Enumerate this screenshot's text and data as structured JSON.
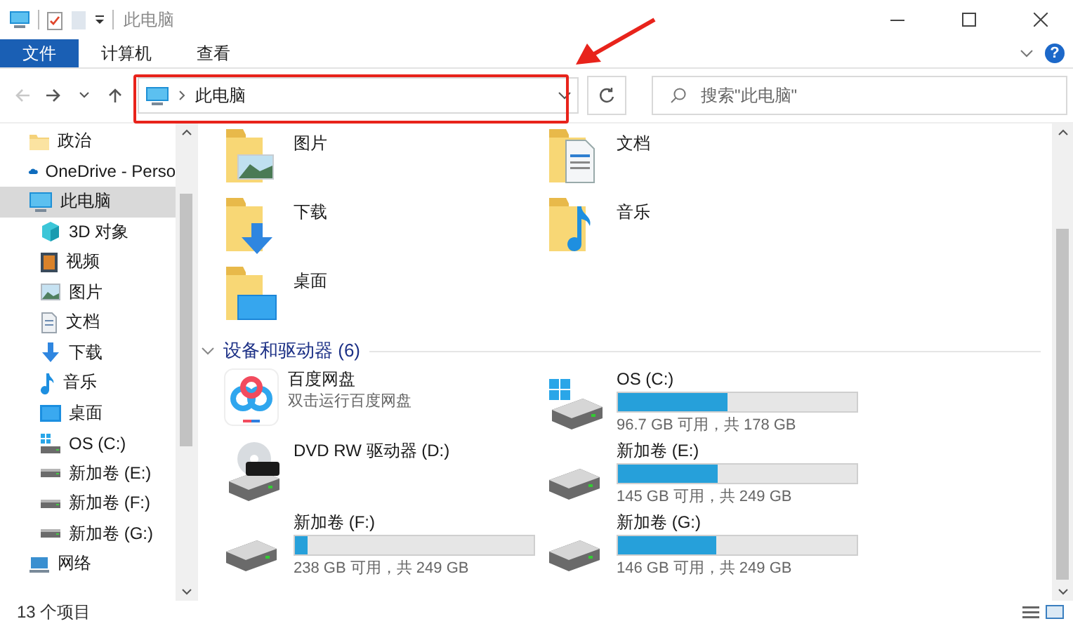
{
  "window": {
    "title": "此电脑"
  },
  "ribbon": {
    "tabs": [
      {
        "label": "文件",
        "selected": true
      },
      {
        "label": "计算机",
        "selected": false
      },
      {
        "label": "查看",
        "selected": false
      }
    ],
    "help": "?"
  },
  "nav": {
    "buttons": [
      {
        "kind": "back",
        "disabled": true
      },
      {
        "kind": "forward",
        "disabled": false
      },
      {
        "kind": "recent",
        "disabled": false
      },
      {
        "kind": "up",
        "disabled": false
      }
    ],
    "address": "此电脑",
    "search": {
      "placeholder": "搜索\"此电脑\""
    }
  },
  "sidebar": {
    "items": [
      {
        "label": "政治",
        "kind": "folder",
        "selected": false
      },
      {
        "label": "OneDrive - Perso",
        "kind": "cloud",
        "selected": false
      },
      {
        "label": "此电脑",
        "kind": "pc",
        "selected": true,
        "children": [
          {
            "label": "3D 对象",
            "kind": "cube",
            "selected": false
          },
          {
            "label": "视频",
            "kind": "video",
            "selected": false
          },
          {
            "label": "图片",
            "kind": "picture",
            "selected": false
          },
          {
            "label": "文档",
            "kind": "document",
            "selected": false
          },
          {
            "label": "下载",
            "kind": "download",
            "selected": false
          },
          {
            "label": "音乐",
            "kind": "music",
            "selected": false
          },
          {
            "label": "桌面",
            "kind": "desktop",
            "selected": false
          },
          {
            "label": "OS (C:)",
            "kind": "os-drive",
            "selected": false
          },
          {
            "label": "新加卷 (E:)",
            "kind": "drive",
            "selected": false
          },
          {
            "label": "新加卷 (F:)",
            "kind": "drive",
            "selected": false
          },
          {
            "label": "新加卷 (G:)",
            "kind": "drive",
            "selected": false
          }
        ]
      },
      {
        "label": "网络",
        "kind": "network",
        "selected": false
      }
    ]
  },
  "folders": [
    {
      "label": "图片",
      "kind": "picture"
    },
    {
      "label": "文档",
      "kind": "document"
    },
    {
      "label": "下载",
      "kind": "download"
    },
    {
      "label": "音乐",
      "kind": "music"
    },
    {
      "label": "桌面",
      "kind": "desktop"
    }
  ],
  "drives": {
    "title": "设备和驱动器 (6)",
    "expanded": true,
    "items": [
      {
        "kind": "app",
        "name": "百度网盘",
        "subtitle": "双击运行百度网盘"
      },
      {
        "kind": "os-drive",
        "name": "OS (C:)",
        "level": 0.46,
        "reading": "96.7 GB 可用，共 178 GB"
      },
      {
        "kind": "dvd",
        "name": "DVD RW 驱动器 (D:)"
      },
      {
        "kind": "drive",
        "name": "新加卷 (E:)",
        "level": 0.42,
        "reading": "145 GB 可用，共 249 GB"
      },
      {
        "kind": "drive",
        "name": "新加卷 (F:)",
        "level": 0.05,
        "reading": "238 GB 可用，共 249 GB"
      },
      {
        "kind": "drive",
        "name": "新加卷 (G:)",
        "level": 0.41,
        "reading": "146 GB 可用，共 249 GB"
      }
    ]
  },
  "status_bar": {
    "count": "13 个项目"
  }
}
